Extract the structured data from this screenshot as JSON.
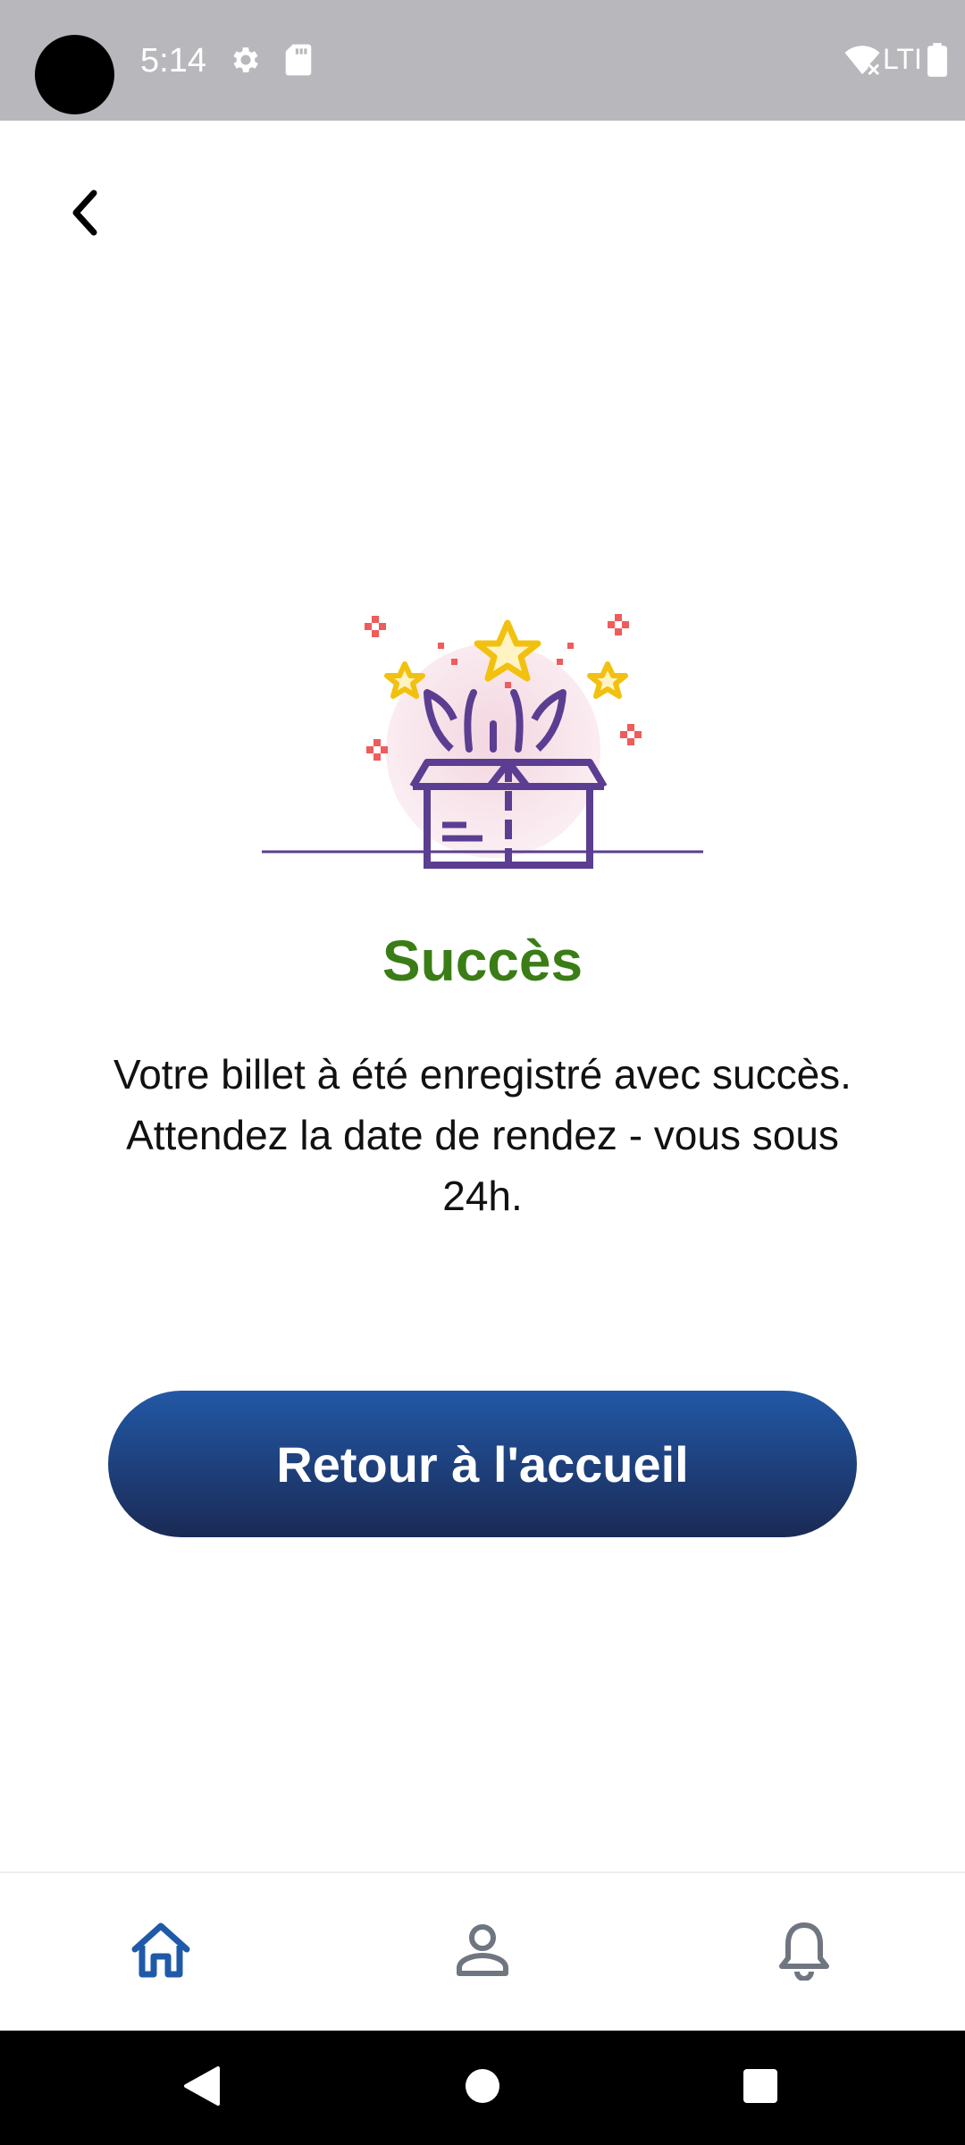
{
  "status_bar": {
    "time": "5:14",
    "network": "LTI"
  },
  "navigation": {
    "back_icon": "chevron-left-icon"
  },
  "success": {
    "title": "Succès",
    "message": "Votre billet à été enregistré avec succès. Attendez la date de rendez - vous sous 24h.",
    "button_label": "Retour à l'accueil"
  },
  "bottom_nav": {
    "items": [
      {
        "icon": "home-icon",
        "active": true
      },
      {
        "icon": "profile-icon",
        "active": false
      },
      {
        "icon": "bell-icon",
        "active": false
      }
    ]
  },
  "colors": {
    "title_green": "#3a7d16",
    "button_top": "#2258a6",
    "button_bottom": "#1a2a55",
    "nav_active": "#1f5aa8",
    "nav_inactive": "#6f7680",
    "illustration_purple": "#5b3e91",
    "illustration_yellow": "#f2c10f",
    "illustration_red": "#ee5c5c"
  }
}
